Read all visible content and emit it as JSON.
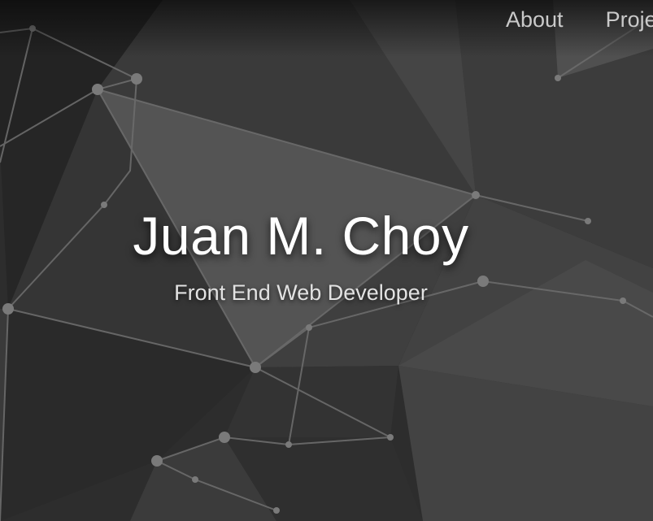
{
  "nav": {
    "items": [
      {
        "label": "About"
      },
      {
        "label": "Projects"
      }
    ]
  },
  "hero": {
    "name": "Juan M. Choy",
    "tagline": "Front End Web Developer"
  },
  "theme": {
    "background": "#2b2b2b",
    "text": "#ffffff",
    "nav_text": "#c9c9c9"
  }
}
